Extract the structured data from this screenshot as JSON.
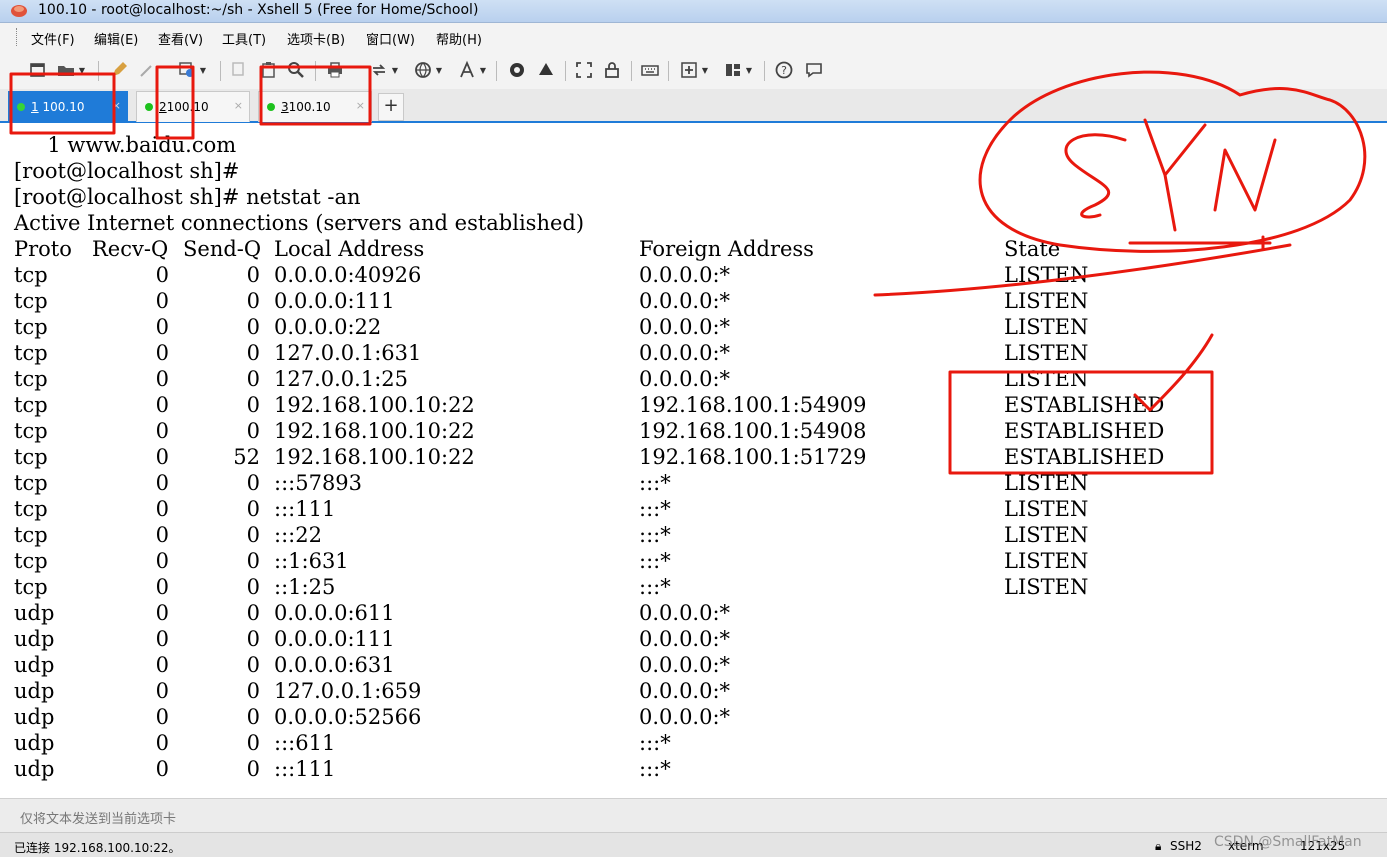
{
  "window": {
    "title": "100.10 - root@localhost:~/sh - Xshell 5 (Free for Home/School)"
  },
  "menu": [
    "文件(F)",
    "编辑(E)",
    "查看(V)",
    "工具(T)",
    "选项卡(B)",
    "窗口(W)",
    "帮助(H)"
  ],
  "tabs": [
    {
      "num": "1",
      "label": "100.10",
      "active": true
    },
    {
      "num": "2",
      "label": "100.10",
      "active": false
    },
    {
      "num": "3",
      "label": "100.10",
      "active": false
    }
  ],
  "add_tab": "+",
  "tab_close": "×",
  "terminal": {
    "lines": [
      "     1 www.baidu.com",
      "[root@localhost sh]#",
      "[root@localhost sh]# netstat -an",
      "Active Internet connections (servers and established)"
    ],
    "header": {
      "proto": "Proto",
      "recvq": "Recv-Q",
      "sendq": "Send-Q",
      "local": "Local Address",
      "foreign": "Foreign Address",
      "state": "State"
    },
    "rows": [
      {
        "proto": "tcp",
        "recvq": "0",
        "sendq": "0",
        "local": "0.0.0.0:40926",
        "foreign": "0.0.0.0:*",
        "state": "LISTEN"
      },
      {
        "proto": "tcp",
        "recvq": "0",
        "sendq": "0",
        "local": "0.0.0.0:111",
        "foreign": "0.0.0.0:*",
        "state": "LISTEN"
      },
      {
        "proto": "tcp",
        "recvq": "0",
        "sendq": "0",
        "local": "0.0.0.0:22",
        "foreign": "0.0.0.0:*",
        "state": "LISTEN"
      },
      {
        "proto": "tcp",
        "recvq": "0",
        "sendq": "0",
        "local": "127.0.0.1:631",
        "foreign": "0.0.0.0:*",
        "state": "LISTEN"
      },
      {
        "proto": "tcp",
        "recvq": "0",
        "sendq": "0",
        "local": "127.0.0.1:25",
        "foreign": "0.0.0.0:*",
        "state": "LISTEN"
      },
      {
        "proto": "tcp",
        "recvq": "0",
        "sendq": "0",
        "local": "192.168.100.10:22",
        "foreign": "192.168.100.1:54909",
        "state": "ESTABLISHED"
      },
      {
        "proto": "tcp",
        "recvq": "0",
        "sendq": "0",
        "local": "192.168.100.10:22",
        "foreign": "192.168.100.1:54908",
        "state": "ESTABLISHED"
      },
      {
        "proto": "tcp",
        "recvq": "0",
        "sendq": "52",
        "local": "192.168.100.10:22",
        "foreign": "192.168.100.1:51729",
        "state": "ESTABLISHED"
      },
      {
        "proto": "tcp",
        "recvq": "0",
        "sendq": "0",
        "local": ":::57893",
        "foreign": ":::*",
        "state": "LISTEN"
      },
      {
        "proto": "tcp",
        "recvq": "0",
        "sendq": "0",
        "local": ":::111",
        "foreign": ":::*",
        "state": "LISTEN"
      },
      {
        "proto": "tcp",
        "recvq": "0",
        "sendq": "0",
        "local": ":::22",
        "foreign": ":::*",
        "state": "LISTEN"
      },
      {
        "proto": "tcp",
        "recvq": "0",
        "sendq": "0",
        "local": "::1:631",
        "foreign": ":::*",
        "state": "LISTEN"
      },
      {
        "proto": "tcp",
        "recvq": "0",
        "sendq": "0",
        "local": "::1:25",
        "foreign": ":::*",
        "state": "LISTEN"
      },
      {
        "proto": "udp",
        "recvq": "0",
        "sendq": "0",
        "local": "0.0.0.0:611",
        "foreign": "0.0.0.0:*",
        "state": ""
      },
      {
        "proto": "udp",
        "recvq": "0",
        "sendq": "0",
        "local": "0.0.0.0:111",
        "foreign": "0.0.0.0:*",
        "state": ""
      },
      {
        "proto": "udp",
        "recvq": "0",
        "sendq": "0",
        "local": "0.0.0.0:631",
        "foreign": "0.0.0.0:*",
        "state": ""
      },
      {
        "proto": "udp",
        "recvq": "0",
        "sendq": "0",
        "local": "127.0.0.1:659",
        "foreign": "0.0.0.0:*",
        "state": ""
      },
      {
        "proto": "udp",
        "recvq": "0",
        "sendq": "0",
        "local": "0.0.0.0:52566",
        "foreign": "0.0.0.0:*",
        "state": ""
      },
      {
        "proto": "udp",
        "recvq": "0",
        "sendq": "0",
        "local": ":::611",
        "foreign": ":::*",
        "state": ""
      },
      {
        "proto": "udp",
        "recvq": "0",
        "sendq": "0",
        "local": ":::111",
        "foreign": ":::*",
        "state": ""
      }
    ]
  },
  "input_bar": {
    "placeholder": "仅将文本发送到当前选项卡"
  },
  "status": {
    "connected": "已连接 192.168.100.10:22。",
    "protocol": "SSH2",
    "terminal": "xterm",
    "size": "121x25"
  },
  "watermark": "CSDN @SmallFatMan",
  "colors": {
    "annotation": "#e8180e",
    "tab_active": "#1f7bd8",
    "status_dot": "#1ec21e"
  },
  "icons": [
    "new-session-icon",
    "open-folder-icon",
    "pencil-icon",
    "key-icon",
    "properties-icon",
    "copy-icon",
    "paste-icon",
    "find-icon",
    "print-icon",
    "transfer-icon",
    "globe-icon",
    "font-icon",
    "xftp-icon",
    "xmanager-icon",
    "fullscreen-icon",
    "lock-icon",
    "keyboard-icon",
    "add-icon",
    "layout-icon",
    "help-icon",
    "chat-icon"
  ]
}
